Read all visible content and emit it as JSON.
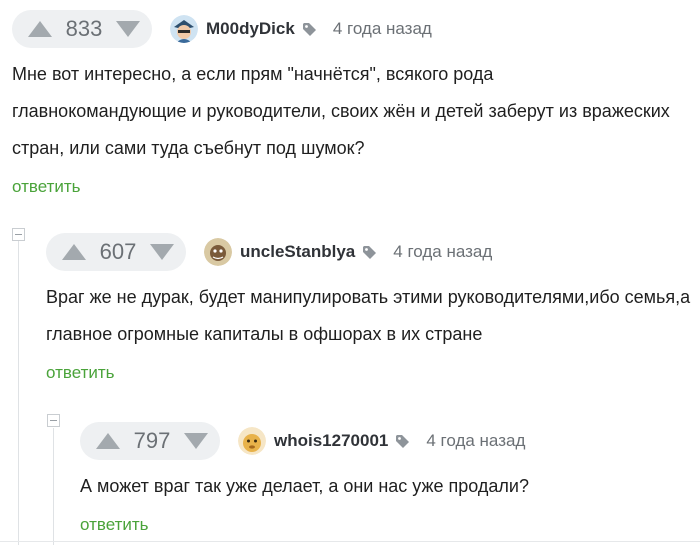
{
  "comments": [
    {
      "score": "833",
      "user": "M00dyDick",
      "time": "4 года назад",
      "text": "Мне вот интересно, а если прям \"начнётся\", всякого рода главнокомандующие и руководители, своих жён и детей заберут из вражеских стран, или сами туда съебнут под шумок?",
      "reply_label": "ответить"
    },
    {
      "score": "607",
      "user": "uncleStanblya",
      "time": "4 года назад",
      "text": "Враг же не дурак, будет манипулировать этими руководителями,ибо семья,а главное огромные капиталы в офшорах в их стране",
      "reply_label": "ответить"
    },
    {
      "score": "797",
      "user": "whois1270001",
      "time": "4 года назад",
      "text": "А может враг так уже делает, а они нас уже продали?",
      "reply_label": "ответить"
    }
  ],
  "colors": {
    "accent": "#4aa33a",
    "vote_bg": "#eef0f2",
    "arrow": "#a3a9ae",
    "username": "#303338",
    "muted": "#6b7075"
  },
  "icons": [
    "upvote-arrow-icon",
    "downvote-arrow-icon",
    "tag-icon",
    "collapse-thread-icon"
  ]
}
